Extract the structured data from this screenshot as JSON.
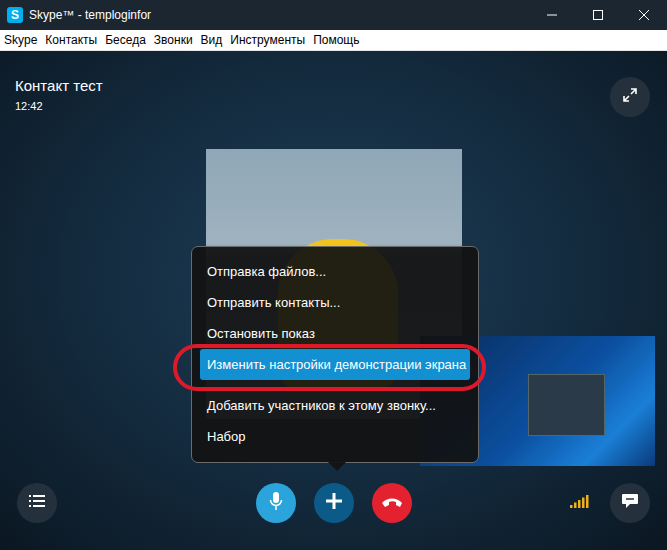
{
  "window": {
    "title": "Skype™ - temploginfor",
    "icon": "S"
  },
  "menu_bar": [
    "Skype",
    "Контакты",
    "Беседа",
    "Звонки",
    "Вид",
    "Инструменты",
    "Помощь"
  ],
  "call": {
    "contact": "Контакт тест",
    "time": "12:42"
  },
  "context_menu": {
    "items": [
      {
        "label": "Отправка файлов...",
        "selected": false
      },
      {
        "label": "Отправить контакты...",
        "selected": false
      },
      {
        "label": "Остановить показ",
        "selected": false
      },
      {
        "label": "Изменить настройки демонстрации экрана",
        "selected": true
      },
      {
        "label": "Добавить участников к этому звонку...",
        "selected": false
      },
      {
        "label": "Набор",
        "selected": false
      }
    ]
  },
  "signal": {
    "level": 1
  }
}
